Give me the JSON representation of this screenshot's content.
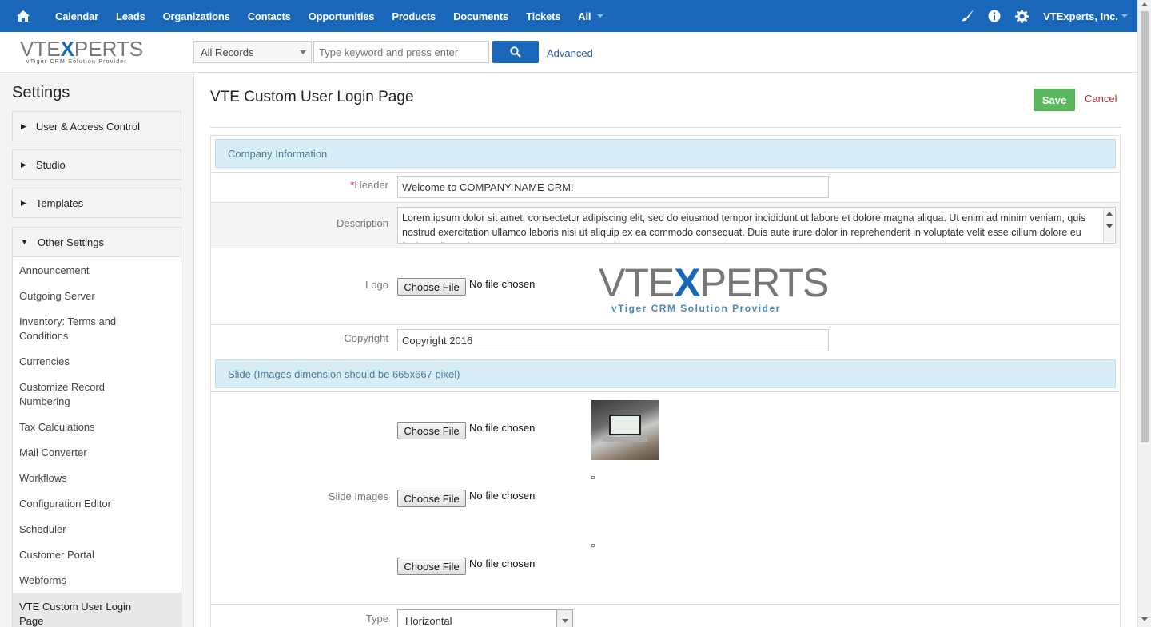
{
  "nav": {
    "home_icon": "home-icon",
    "items": [
      "Calendar",
      "Leads",
      "Organizations",
      "Contacts",
      "Opportunities",
      "Products",
      "Documents",
      "Tickets",
      "All"
    ],
    "right_icons": [
      "brush-icon",
      "info-icon",
      "gear-icon"
    ],
    "user": "VTExperts, Inc."
  },
  "header": {
    "logo_text_a": "VTE",
    "logo_text_b": "X",
    "logo_text_c": "PERTS",
    "logo_tagline": "vTiger CRM Solution Provider",
    "records_select": "All Records",
    "search_placeholder": "Type keyword and press enter",
    "advanced": "Advanced",
    "plus_icon": "plus-icon"
  },
  "sidebar": {
    "title": "Settings",
    "blocks": [
      "User & Access Control",
      "Studio",
      "Templates",
      "Other Settings"
    ],
    "items": [
      "Announcement",
      "Outgoing Server",
      "Inventory: Terms and",
      "Conditions",
      "Currencies",
      "Customize Record",
      "Numbering",
      "Tax Calculations",
      "Mail Converter",
      "Workflows",
      "Configuration Editor",
      "Scheduler",
      "Customer Portal",
      "Webforms",
      "VTE Custom User Login",
      "Page"
    ]
  },
  "main": {
    "title": "VTE Custom User Login Page",
    "save": "Save",
    "cancel": "Cancel",
    "section1": "Company Information",
    "header_label": "Header",
    "header_req": "*",
    "header_value": "Welcome to COMPANY NAME CRM!",
    "description_label": "Description",
    "description_value": "Lorem ipsum dolor sit amet, consectetur adipiscing elit, sed do eiusmod tempor incididunt ut labore et dolore magna aliqua. Ut enim ad minim veniam, quis nostrud exercitation ullamco laboris nisi ut aliquip ex ea commodo consequat. Duis aute irure dolor in reprehenderit in voluptate velit esse cillum dolore eu fugiat nulla pariatur.",
    "logo_label": "Logo",
    "choose_file": "Choose File",
    "no_file": "No file chosen",
    "copyright_label": "Copyright",
    "copyright_value": "Copyright 2016",
    "section2": "Slide (Images dimension should be 665x667 pixel)",
    "slide_label": "Slide Images",
    "type_label": "Type",
    "type_value": "Horizontal"
  }
}
